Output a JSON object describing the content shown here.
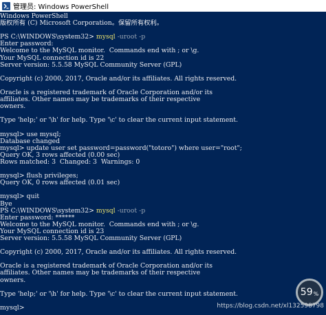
{
  "window": {
    "title": "管理员: Windows PowerShell"
  },
  "console": {
    "lines": [
      {
        "text": "Windows PowerShell"
      },
      {
        "text": "版权所有 (C) Microsoft Corporation。保留所有权利。"
      },
      {
        "text": ""
      },
      {
        "prompt": "PS C:\\WINDOWS\\system32> ",
        "cmd": "mysql",
        "arg": " -uroot -p"
      },
      {
        "text": "Enter password:"
      },
      {
        "text": "Welcome to the MySQL monitor.  Commands end with ; or \\g."
      },
      {
        "text": "Your MySQL connection id is 22"
      },
      {
        "text": "Server version: 5.5.58 MySQL Community Server (GPL)"
      },
      {
        "text": ""
      },
      {
        "text": "Copyright (c) 2000, 2017, Oracle and/or its affiliates. All rights reserved."
      },
      {
        "text": ""
      },
      {
        "text": "Oracle is a registered trademark of Oracle Corporation and/or its"
      },
      {
        "text": "affiliates. Other names may be trademarks of their respective"
      },
      {
        "text": "owners."
      },
      {
        "text": ""
      },
      {
        "text": "Type 'help;' or '\\h' for help. Type '\\c' to clear the current input statement."
      },
      {
        "text": ""
      },
      {
        "text": "mysql> use mysql;"
      },
      {
        "text": "Database changed"
      },
      {
        "text": "mysql> update user set password=password(\"totoro\") where user=\"root\";"
      },
      {
        "text": "Query OK, 3 rows affected (0.00 sec)"
      },
      {
        "text": "Rows matched: 3  Changed: 3  Warnings: 0"
      },
      {
        "text": ""
      },
      {
        "text": "mysql> flush privileges;"
      },
      {
        "text": "Query OK, 0 rows affected (0.01 sec)"
      },
      {
        "text": ""
      },
      {
        "text": "mysql> quit"
      },
      {
        "text": "Bye"
      },
      {
        "prompt": "PS C:\\WINDOWS\\system32> ",
        "cmd": "mysql",
        "arg": " -uroot -p"
      },
      {
        "text": "Enter password: ******"
      },
      {
        "text": "Welcome to the MySQL monitor.  Commands end with ; or \\g."
      },
      {
        "text": "Your MySQL connection id is 23"
      },
      {
        "text": "Server version: 5.5.58 MySQL Community Server (GPL)"
      },
      {
        "text": ""
      },
      {
        "text": "Copyright (c) 2000, 2017, Oracle and/or its affiliates. All rights reserved."
      },
      {
        "text": ""
      },
      {
        "text": "Oracle is a registered trademark of Oracle Corporation and/or its"
      },
      {
        "text": "affiliates. Other names may be trademarks of their respective"
      },
      {
        "text": "owners."
      },
      {
        "text": ""
      },
      {
        "text": "Type 'help;' or '\\h' for help. Type '\\c' to clear the current input statement."
      },
      {
        "text": ""
      },
      {
        "text": "mysql> "
      }
    ]
  },
  "overlay": {
    "value": "59",
    "unit": "%"
  },
  "watermark": "https://blog.csdn.net/xl132598798",
  "colors": {
    "background": "#012456",
    "text": "#eeedf0",
    "command": "#ece36f",
    "argument": "#9aa6b4"
  },
  "icons": {
    "title": "powershell-icon"
  }
}
